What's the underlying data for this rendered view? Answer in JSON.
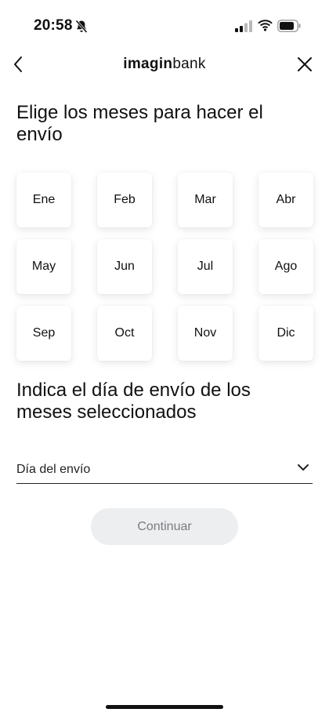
{
  "status_bar": {
    "time": "20:58",
    "icons": [
      "bell-slash-icon",
      "signal-icon",
      "wifi-icon",
      "battery-icon"
    ]
  },
  "nav": {
    "brand_bold": "imagin",
    "brand_regular": "bank",
    "back_icon": "chevron-left-icon",
    "close_icon": "close-icon"
  },
  "months_section": {
    "title": "Elige los meses para hacer el envío",
    "months": [
      "Ene",
      "Feb",
      "Mar",
      "Abr",
      "May",
      "Jun",
      "Jul",
      "Ago",
      "Sep",
      "Oct",
      "Nov",
      "Dic"
    ]
  },
  "day_section": {
    "title": "Indica el día de envío de los meses seleccionados",
    "select_label": "Día del envío",
    "select_icon": "chevron-down-icon"
  },
  "actions": {
    "continue_label": "Continuar",
    "continue_enabled": false
  },
  "colors": {
    "text": "#111111",
    "button_disabled_bg": "#eceef0",
    "button_disabled_text": "#7a7c80"
  }
}
